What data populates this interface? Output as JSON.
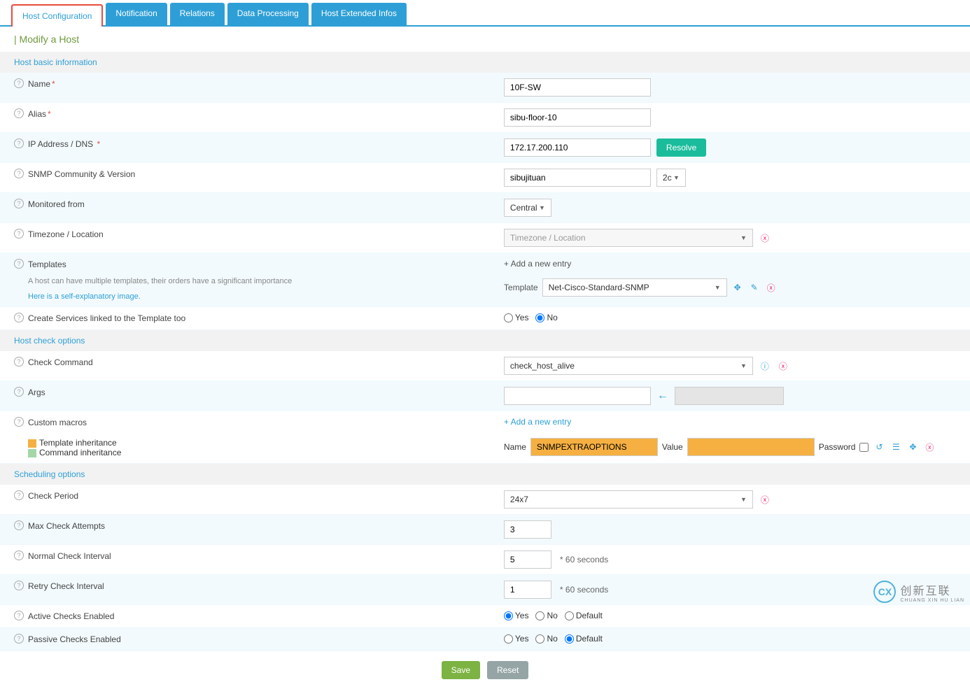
{
  "tabs": {
    "host_config": "Host Configuration",
    "notification": "Notification",
    "relations": "Relations",
    "data_processing": "Data Processing",
    "host_ext": "Host Extended Infos"
  },
  "page_title": "| Modify a Host",
  "sections": {
    "basic": "Host basic information",
    "check": "Host check options",
    "scheduling": "Scheduling options"
  },
  "labels": {
    "name": "Name",
    "alias": "Alias",
    "ip": "IP Address / DNS",
    "snmp": "SNMP Community & Version",
    "monitored": "Monitored from",
    "timezone": "Timezone / Location",
    "templates": "Templates",
    "templates_sub": "A host can have multiple templates, their orders have a significant importance",
    "templates_link": "Here is a self-explanatory image.",
    "create_services": "Create Services linked to the Template too",
    "check_command": "Check Command",
    "args": "Args",
    "custom_macros": "Custom macros",
    "tpl_inherit": "Template inheritance",
    "cmd_inherit": "Command inheritance",
    "check_period": "Check Period",
    "max_attempts": "Max Check Attempts",
    "normal_interval": "Normal Check Interval",
    "retry_interval": "Retry Check Interval",
    "active_checks": "Active Checks Enabled",
    "passive_checks": "Passive Checks Enabled"
  },
  "values": {
    "name": "10F-SW",
    "alias": "sibu-floor-10",
    "ip": "172.17.200.110",
    "snmp_community": "sibujituan",
    "snmp_version": "2c",
    "monitored": "Central",
    "timezone_placeholder": "Timezone / Location",
    "template_selected": "Net-Cisco-Standard-SNMP",
    "check_command": "check_host_alive",
    "args": "",
    "macro_name": "SNMPEXTRAOPTIONS",
    "macro_value": "",
    "check_period": "24x7",
    "max_attempts": "3",
    "normal_interval": "5",
    "retry_interval": "1"
  },
  "misc": {
    "resolve": "Resolve",
    "add_entry": "+ Add a new entry",
    "template_label": "Template",
    "macro_name_label": "Name",
    "macro_value_label": "Value",
    "macro_password_label": "Password",
    "yes": "Yes",
    "no": "No",
    "default": "Default",
    "interval_suffix": "* 60 seconds",
    "save": "Save",
    "reset": "Reset"
  },
  "watermark": {
    "logo": "CX",
    "text": "创新互联",
    "sub": "CHUANG XIN HU LIAN"
  }
}
